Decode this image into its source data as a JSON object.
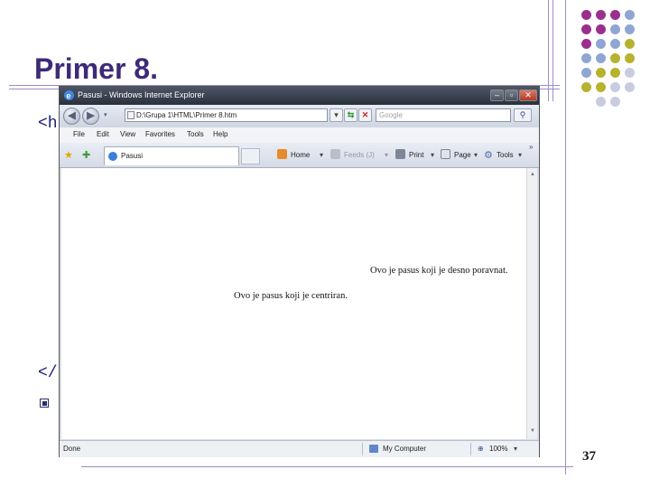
{
  "slide": {
    "title": "Primer 8.",
    "code_open": "<h",
    "code_close": "</",
    "page_number": "37"
  },
  "browser": {
    "window_title": "Pasusi - Windows Internet Explorer",
    "address": "D:\\Grupa 1\\HTML\\Primer 8.htm",
    "search_placeholder": "Google",
    "menu": [
      "File",
      "Edit",
      "View",
      "Favorites",
      "Tools",
      "Help"
    ],
    "tab_label": "Pasusi",
    "commands": {
      "home": "Home",
      "feeds": "Feeds (J)",
      "print": "Print",
      "page": "Page",
      "tools": "Tools"
    },
    "content": {
      "right_paragraph": "Ovo je pasus koji je desno poravnat.",
      "center_paragraph": "Ovo je pasus koji je centriran."
    },
    "status": {
      "left": "Done",
      "zone": "My Computer",
      "zoom": "100%"
    }
  },
  "colors": {
    "title": "#3e2a78",
    "dot_purple": "#9b2f8e",
    "dot_blue": "#8fa6d3",
    "dot_olive": "#b7b22f",
    "dot_grey": "#c9cbe0"
  }
}
